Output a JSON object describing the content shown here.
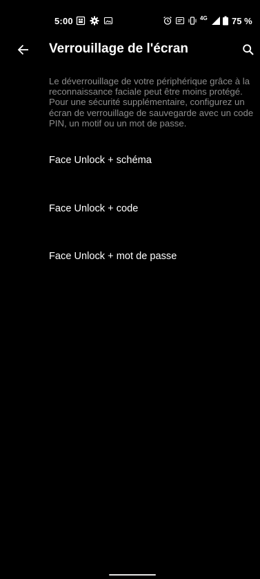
{
  "status_bar": {
    "time": "5:00",
    "network": "4G",
    "battery_percent": "75 %",
    "icons": [
      "photo-app-icon",
      "settings-gear-icon",
      "image-icon",
      "alarm-icon",
      "nfc-icon",
      "vibrate-icon",
      "network-4g-icon",
      "signal-icon",
      "battery-icon"
    ]
  },
  "app_bar": {
    "title": "Verrouillage de l'écran",
    "back_icon": "arrow-back-icon",
    "search_icon": "search-icon"
  },
  "description": "Le déverrouillage de votre périphérique grâce à la reconnaissance faciale peut être moins protégé. Pour une sécurité supplémentaire, configurez un écran de verrouillage de sauvegarde avec un code PIN, un motif ou un mot de passe.",
  "options": [
    {
      "label": "Face Unlock + schéma"
    },
    {
      "label": "Face Unlock + code"
    },
    {
      "label": "Face Unlock + mot de passe"
    }
  ],
  "colors": {
    "background": "#000000",
    "text_primary": "#ffffff",
    "text_secondary": "#8c8c8c"
  }
}
